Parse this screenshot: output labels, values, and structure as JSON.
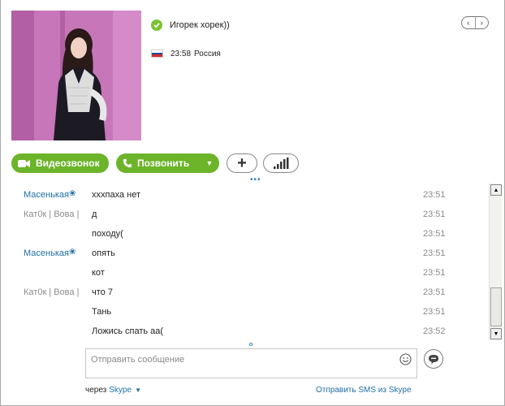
{
  "contact": {
    "mood": "Игорек хорек))",
    "time": "23:58",
    "country": "Россия",
    "status": "online"
  },
  "nav": {
    "prev": "‹",
    "next": "›"
  },
  "actions": {
    "video_label": "Видеозвонок",
    "call_label": "Позвонить"
  },
  "chat": {
    "messages": [
      {
        "sender": "Масенькая",
        "text": "хххпаха нет",
        "time": "23:51"
      },
      {
        "sender": "Кат0к | Вова |",
        "text": "д",
        "time": "23:51"
      },
      {
        "sender": "",
        "text": "походу(",
        "time": "23:51"
      },
      {
        "sender": "Масенькая",
        "text": "опять",
        "time": "23:51"
      },
      {
        "sender": "",
        "text": "кот",
        "time": "23:51"
      },
      {
        "sender": "Кат0к | Вова |",
        "text": "что 7",
        "time": "23:51"
      },
      {
        "sender": "",
        "text": "Тань",
        "time": "23:51"
      },
      {
        "sender": "",
        "text": "Ложись спать аа(",
        "time": "23:52"
      }
    ]
  },
  "compose": {
    "placeholder": "Отправить сообщение",
    "via_label": "через",
    "via_service": "Skype",
    "sms_link": "Отправить SMS из Skype"
  },
  "colors": {
    "accent_green": "#6cb42a",
    "link_blue": "#1f6fa5",
    "muted_gray": "#8b8b8b"
  },
  "icons": {
    "status": "online-check-icon",
    "flag": "russia-flag-icon",
    "video": "video-camera-icon",
    "call": "phone-icon",
    "add": "plus-icon",
    "quality": "signal-bars-icon",
    "emoticon": "smiley-icon",
    "send": "chat-bubble-icon"
  }
}
